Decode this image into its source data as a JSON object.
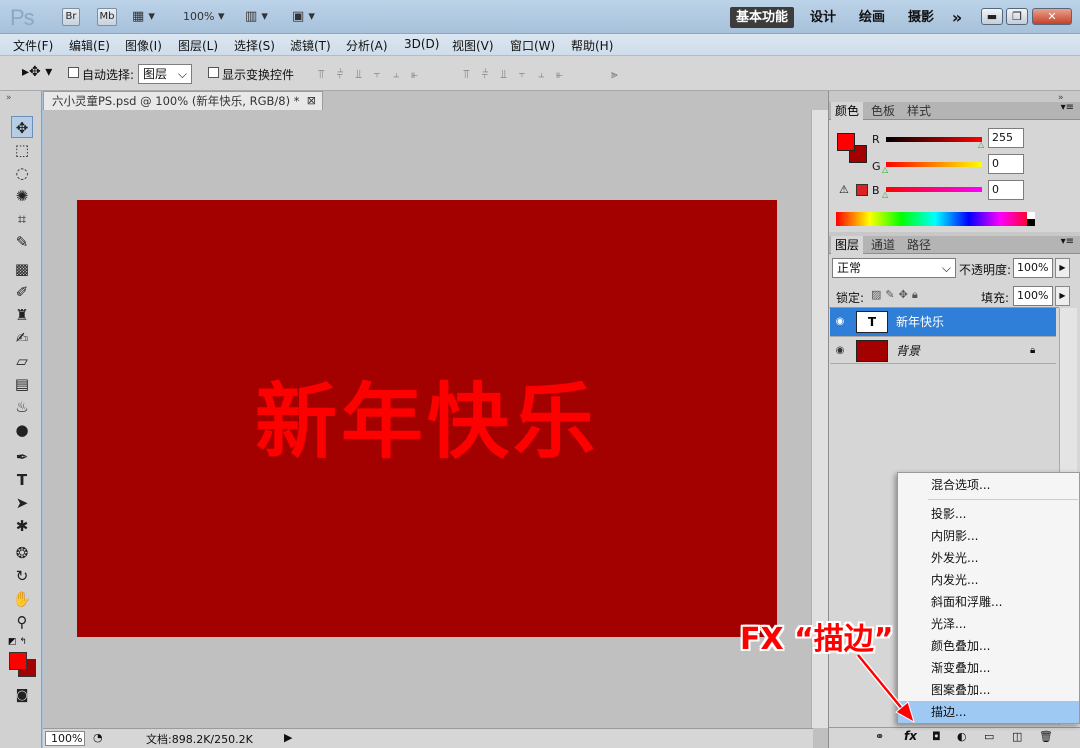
{
  "app": {
    "logo": "Ps",
    "br_label": "Br",
    "mb_label": "Mb",
    "zoom": "100%",
    "workspaces": [
      "基本功能",
      "设计",
      "绘画",
      "摄影"
    ],
    "more": "»"
  },
  "menubar": [
    "文件(F)",
    "编辑(E)",
    "图像(I)",
    "图层(L)",
    "选择(S)",
    "滤镜(T)",
    "分析(A)",
    "3D(D)",
    "视图(V)",
    "窗口(W)",
    "帮助(H)"
  ],
  "options": {
    "auto_select_label": "自动选择:",
    "auto_select_value": "图层",
    "show_transform_label": "显示变换控件"
  },
  "document": {
    "tab_title": "六小灵童PS.psd @ 100% (新年快乐, RGB/8) *",
    "canvas_text": "新年快乐",
    "canvas_color": "#a30000",
    "text_color": "#ff0000",
    "status_zoom": "100%",
    "status_doc": "文档:898.2K/250.2K"
  },
  "color_panel": {
    "tabs": [
      "颜色",
      "色板",
      "样式"
    ],
    "r_label": "R",
    "g_label": "G",
    "b_label": "B",
    "r_value": "255",
    "g_value": "0",
    "b_value": "0",
    "fg_color": "#ff0000",
    "bg_color": "#a30000"
  },
  "layers_panel": {
    "tabs": [
      "图层",
      "通道",
      "路径"
    ],
    "blend_mode": "正常",
    "opacity_label": "不透明度:",
    "opacity_value": "100%",
    "lock_label": "锁定:",
    "fill_label": "填充:",
    "fill_value": "100%",
    "layers": [
      {
        "name": "新年快乐",
        "thumb": "T"
      },
      {
        "name": "背景",
        "thumb": ""
      }
    ]
  },
  "fx_menu": {
    "items": [
      "混合选项...",
      "投影...",
      "内阴影...",
      "外发光...",
      "内发光...",
      "斜面和浮雕...",
      "光泽...",
      "颜色叠加...",
      "渐变叠加...",
      "图案叠加...",
      "描边..."
    ],
    "highlighted": "描边..."
  },
  "annotation": {
    "text": "FX “描边”"
  },
  "fx_button_label": "fx"
}
